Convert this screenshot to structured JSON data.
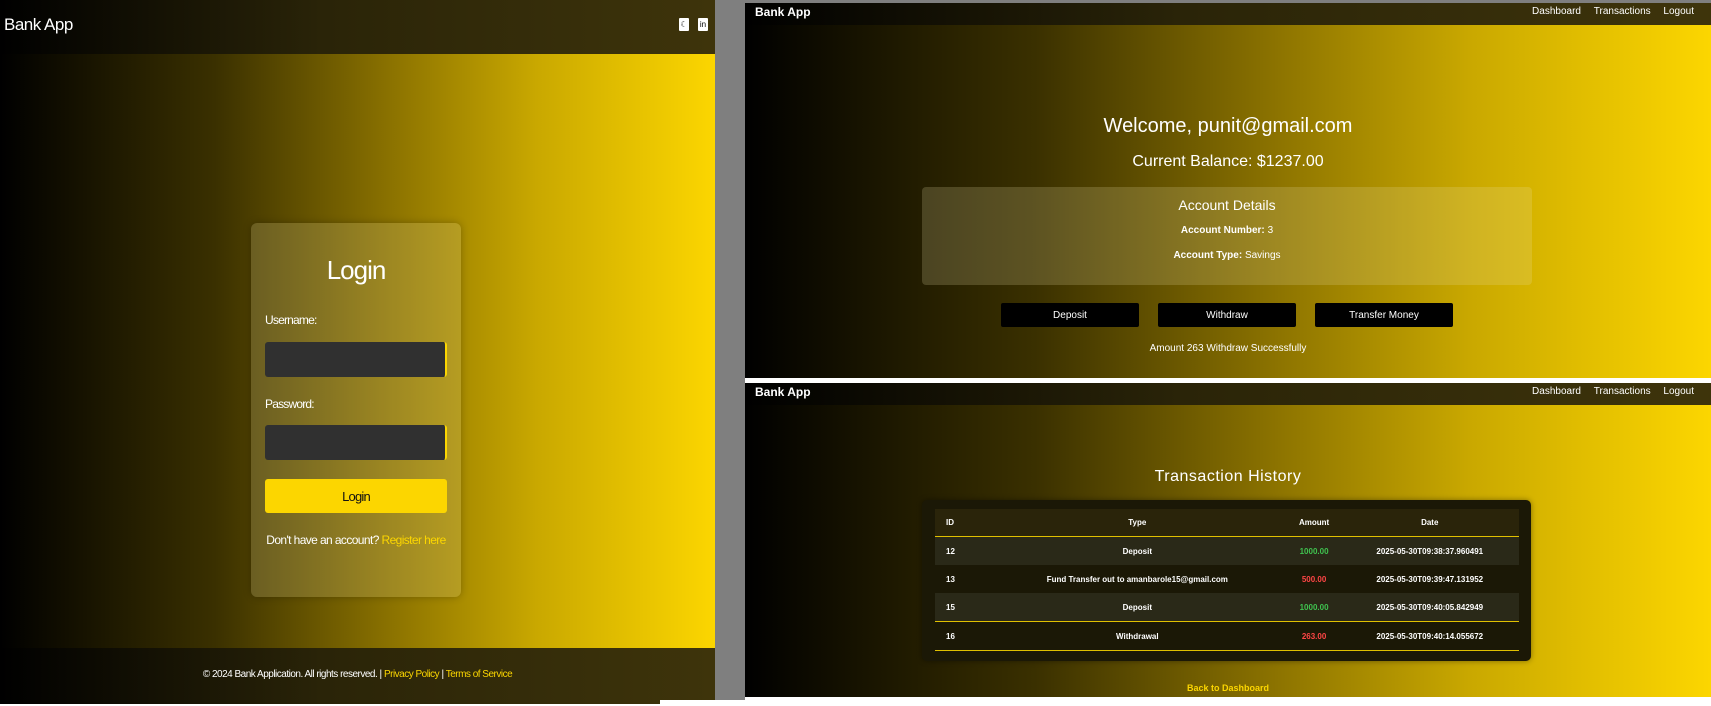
{
  "login_page": {
    "brand": "Bank App",
    "header_icons": [
      "moon-icon",
      "linkedin-icon"
    ],
    "title": "Login",
    "username_label": "Username:",
    "username_value": "",
    "password_label": "Password:",
    "password_value": "",
    "login_button": "Login",
    "register_prompt": "Don't have an account?",
    "register_link": "Register here",
    "footer_text": "© 2024 Bank Application. All rights reserved. |",
    "footer_privacy": "Privacy Policy",
    "footer_sep": "|",
    "footer_terms": "Terms of Service"
  },
  "dashboard": {
    "brand": "Bank App",
    "nav": [
      "Dashboard",
      "Transactions",
      "Logout"
    ],
    "welcome": "Welcome, punit@gmail.com",
    "balance": "Current Balance: $1237.00",
    "account_details_title": "Account Details",
    "account_number_label": "Account Number:",
    "account_number_value": "3",
    "account_type_label": "Account Type:",
    "account_type_value": "Savings",
    "buttons": [
      "Deposit",
      "Withdraw",
      "Transfer Money"
    ],
    "status_message": "Amount 263 Withdraw Successfully"
  },
  "transactions": {
    "brand": "Bank App",
    "nav": [
      "Dashboard",
      "Transactions",
      "Logout"
    ],
    "title": "Transaction History",
    "columns": [
      "ID",
      "Type",
      "Amount",
      "Date"
    ],
    "rows": [
      {
        "id": "12",
        "type": "Deposit",
        "amount": "1000.00",
        "date": "2025-05-30T09:38:37.960491"
      },
      {
        "id": "13",
        "type": "Fund Transfer out to amanbarole15@gmail.com",
        "amount": "500.00",
        "date": "2025-05-30T09:39:47.131952"
      },
      {
        "id": "15",
        "type": "Deposit",
        "amount": "1000.00",
        "date": "2025-05-30T09:40:05.842949"
      },
      {
        "id": "16",
        "type": "Withdrawal",
        "amount": "263.00",
        "date": "2025-05-30T09:40:14.055672"
      }
    ],
    "back_link": "Back to Dashboard"
  },
  "colors": {
    "accent": "#fcd600",
    "positive": "#3fc24f",
    "negative": "#ff4545"
  }
}
